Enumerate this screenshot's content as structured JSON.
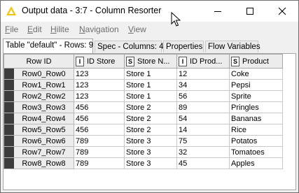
{
  "window": {
    "title": "Output data - 3:7 - Column Resorter",
    "colors": {
      "icon": "#f5c400",
      "titlebar": "#ffffff",
      "rowid_bar": "#3c3c3c"
    },
    "controls": [
      "minimize-icon",
      "maximize-icon",
      "close-icon"
    ]
  },
  "menu": {
    "items": [
      {
        "underline": "F",
        "rest": "ile"
      },
      {
        "underline": "E",
        "rest": "dit"
      },
      {
        "underline": "H",
        "rest": "ilite"
      },
      {
        "underline": "N",
        "rest": "avigation"
      },
      {
        "underline": "V",
        "rest": "iew"
      }
    ]
  },
  "tabs": [
    {
      "label": "Table \"default\" - Rows: 9",
      "active": true
    },
    {
      "label": "Spec - Columns: 4",
      "active": false
    },
    {
      "label": "Properties",
      "active": false
    },
    {
      "label": "Flow Variables",
      "active": false
    }
  ],
  "table": {
    "headers": [
      {
        "type": "",
        "label": "Row ID"
      },
      {
        "type": "I",
        "label": "ID Store"
      },
      {
        "type": "S",
        "label": "Store N..."
      },
      {
        "type": "I",
        "label": "ID Prod..."
      },
      {
        "type": "S",
        "label": "Product"
      }
    ],
    "rows": [
      [
        "Row0_Row0",
        "123",
        "Store 1",
        "12",
        "Coke"
      ],
      [
        "Row1_Row1",
        "123",
        "Store 1",
        "34",
        "Pepsi"
      ],
      [
        "Row2_Row2",
        "123",
        "Store 1",
        "56",
        "Sprite"
      ],
      [
        "Row3_Row3",
        "456",
        "Store 2",
        "89",
        "Pringles"
      ],
      [
        "Row4_Row4",
        "456",
        "Store 2",
        "54",
        "Bananas"
      ],
      [
        "Row5_Row5",
        "456",
        "Store 2",
        "14",
        "Rice"
      ],
      [
        "Row6_Row6",
        "789",
        "Store 3",
        "75",
        "Potatos"
      ],
      [
        "Row7_Row7",
        "789",
        "Store 3",
        "32",
        "Tomatoes"
      ],
      [
        "Row8_Row8",
        "789",
        "Store 3",
        "45",
        "Apples"
      ]
    ]
  }
}
